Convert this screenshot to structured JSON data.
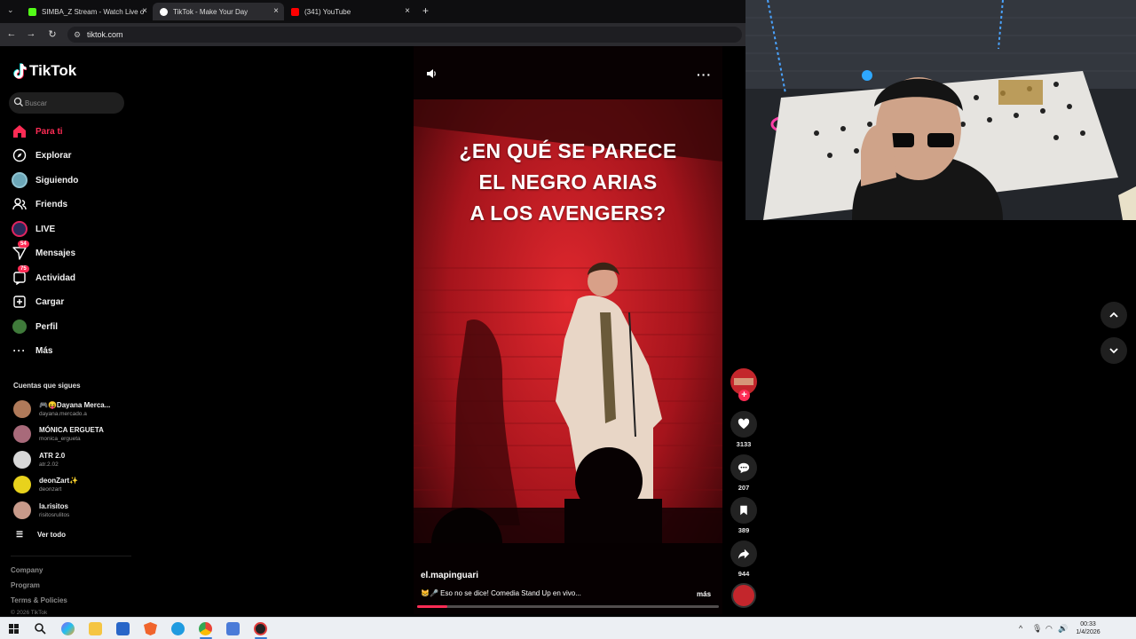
{
  "browser": {
    "tabs": [
      {
        "title": "SIMBA_Z Stream - Watch Live o",
        "favicon_color": "#53fc18"
      },
      {
        "title": "TikTok - Make Your Day",
        "favicon_color": "#ffffff"
      },
      {
        "title": "(341) YouTube",
        "favicon_color": "#ff0000"
      }
    ],
    "url": "tiktok.com"
  },
  "sidebar": {
    "logo": "TikTok",
    "search_placeholder": "Buscar",
    "nav": [
      {
        "label": "Para ti",
        "icon": "home-icon",
        "active": true
      },
      {
        "label": "Explorar",
        "icon": "compass-icon"
      },
      {
        "label": "Siguiendo",
        "icon": "following-avatar-icon"
      },
      {
        "label": "Friends",
        "icon": "friends-icon"
      },
      {
        "label": "LIVE",
        "icon": "live-icon"
      },
      {
        "label": "Mensajes",
        "icon": "messages-icon",
        "badge": "54"
      },
      {
        "label": "Actividad",
        "icon": "activity-icon",
        "badge": "75"
      },
      {
        "label": "Cargar",
        "icon": "upload-icon"
      },
      {
        "label": "Perfil",
        "icon": "profile-icon"
      },
      {
        "label": "Más",
        "icon": "more-icon"
      }
    ],
    "following_title": "Cuentas que sigues",
    "following": [
      {
        "name": "🎮😝Dayana Merca...",
        "handle": "dayana.mercado.a",
        "color": "#b07a5a"
      },
      {
        "name": "MÓNICA ERGUETA",
        "handle": "monica_ergueta",
        "color": "#a86a7a"
      },
      {
        "name": "ATR 2.0",
        "handle": "atr.2.02",
        "color": "#d8d8d8"
      },
      {
        "name": "deonZart✨",
        "handle": "deonzart",
        "color": "#e8d21c"
      },
      {
        "name": "la.risitos",
        "handle": "risitosrulitos",
        "color": "#c89a8a"
      }
    ],
    "see_all": "Ver todo",
    "footer": [
      "Company",
      "Program",
      "Terms & Policies"
    ],
    "copyright": "© 2026 TikTok"
  },
  "video": {
    "caption_lines": [
      "¿EN QUÉ SE PARECE",
      "EL NEGRO ARIAS",
      "A LOS AVENGERS?"
    ],
    "author": "el.mapinguari",
    "description": "😸🎤 Eso no se dice! Comedia Stand Up en vivo...",
    "more": "más",
    "progress": 0.1
  },
  "actions": {
    "likes": "3133",
    "comments": "207",
    "saves": "389",
    "shares": "944"
  },
  "taskbar": {
    "time": "00:33",
    "date": "1/4/2026"
  },
  "colors": {
    "accent": "#fe2c55",
    "background": "#000000"
  }
}
